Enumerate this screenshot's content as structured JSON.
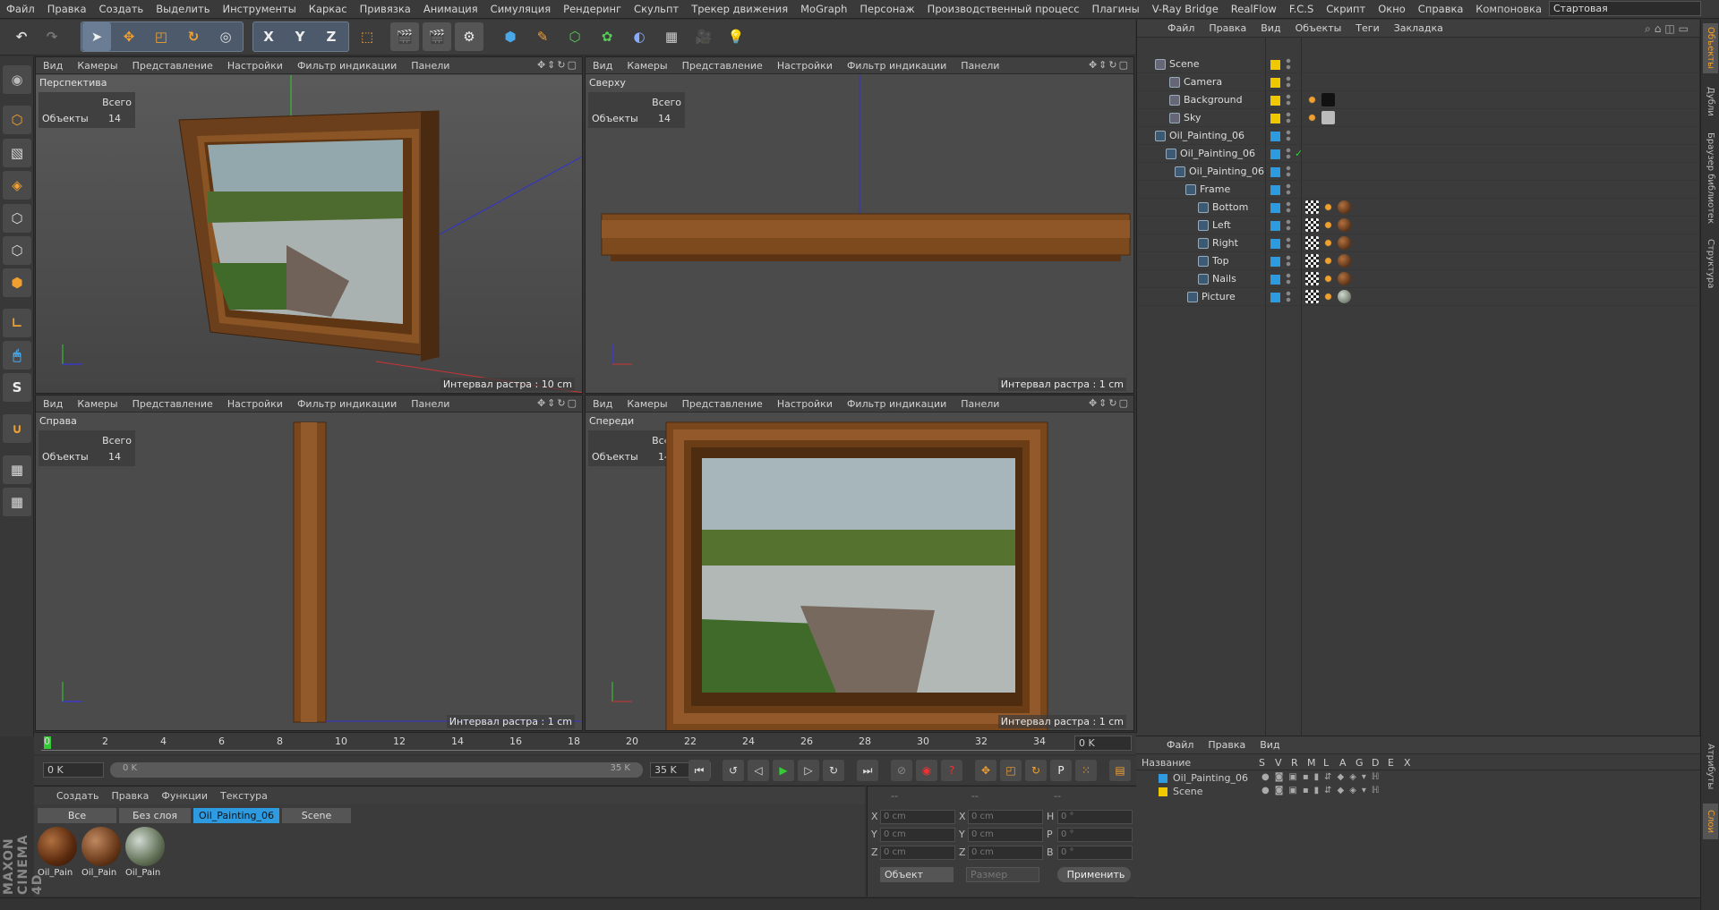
{
  "menubar": {
    "items": [
      "Файл",
      "Правка",
      "Создать",
      "Выделить",
      "Инструменты",
      "Каркас",
      "Привязка",
      "Анимация",
      "Симуляция",
      "Рендеринг",
      "Скульпт",
      "Трекер движения",
      "MoGraph",
      "Персонаж",
      "Производственный процесс",
      "Плагины",
      "V-Ray Bridge",
      "RealFlow",
      "F.C.S",
      "Скрипт",
      "Окно",
      "Справка"
    ],
    "layout_label": "Компоновка",
    "layout_value": "Стартовая"
  },
  "toolbar": {
    "icons": [
      "undo-icon",
      "redo-icon",
      "select-icon",
      "move-icon",
      "scale-icon",
      "rotate-icon",
      "live-select-icon",
      "x-axis-icon",
      "y-axis-icon",
      "z-axis-icon",
      "coord-system-icon",
      "render-view-icon",
      "render-picture-icon",
      "render-settings-icon",
      "cube-icon",
      "pen-icon",
      "subdivision-icon",
      "mograph-icon",
      "deformer-icon",
      "floor-icon",
      "camera-icon",
      "light-icon"
    ],
    "axis_labels": [
      "X",
      "Y",
      "Z"
    ]
  },
  "viewport_menu": [
    "Вид",
    "Камеры",
    "Представление",
    "Настройки",
    "Фильтр индикации",
    "Панели"
  ],
  "viewports": [
    {
      "name": "Перспектива",
      "grid": "Интервал растра : 10 cm"
    },
    {
      "name": "Сверху",
      "grid": "Интервал растра : 1 cm"
    },
    {
      "name": "Справа",
      "grid": "Интервал растра : 1 cm"
    },
    {
      "name": "Спереди",
      "grid": "Интервал растра : 1 cm"
    }
  ],
  "hud": {
    "total_label": "Всего",
    "objects_label": "Объекты",
    "objects_count": "14"
  },
  "object_manager": {
    "menu": [
      "Файл",
      "Правка",
      "Вид",
      "Объекты",
      "Теги",
      "Закладка"
    ],
    "rows": [
      {
        "name": "Scene",
        "color": "#f0c800"
      },
      {
        "name": "Camera",
        "color": "#f0c800"
      },
      {
        "name": "Background",
        "color": "#f0c800"
      },
      {
        "name": "Sky",
        "color": "#f0c800"
      },
      {
        "name": "Oil_Painting_06",
        "color": "#2e9ae0"
      },
      {
        "name": "Oil_Painting_06",
        "color": "#2e9ae0"
      },
      {
        "name": "Oil_Painting_06",
        "color": "#2e9ae0"
      },
      {
        "name": "Frame",
        "color": "#2e9ae0"
      },
      {
        "name": "Bottom",
        "color": "#2e9ae0"
      },
      {
        "name": "Left",
        "color": "#2e9ae0"
      },
      {
        "name": "Right",
        "color": "#2e9ae0"
      },
      {
        "name": "Top",
        "color": "#2e9ae0"
      },
      {
        "name": "Nails",
        "color": "#2e9ae0"
      },
      {
        "name": "Picture",
        "color": "#2e9ae0"
      }
    ]
  },
  "side_tabs": [
    "Объекты",
    "Дубли",
    "Браузер библиотек",
    "Структура",
    "Атрибуты",
    "Слои"
  ],
  "timeline": {
    "ticks": [
      "0",
      "2",
      "4",
      "6",
      "8",
      "10",
      "12",
      "14",
      "16",
      "18",
      "20",
      "22",
      "24",
      "26",
      "28",
      "30",
      "32",
      "34"
    ],
    "end_field": "0 K"
  },
  "transport": {
    "start": "0 K",
    "range_start": "0 K",
    "range_end": "35 K",
    "end": "35 K"
  },
  "material_manager": {
    "menu": [
      "Создать",
      "Правка",
      "Функции",
      "Текстура"
    ],
    "tabs": [
      "Все",
      "Без слоя",
      "Oil_Painting_06",
      "Scene"
    ],
    "materials": [
      {
        "label": "Oil_Pain"
      },
      {
        "label": "Oil_Pain"
      },
      {
        "label": "Oil_Pain"
      }
    ]
  },
  "coordinates": {
    "header": [
      "--",
      "--",
      "--"
    ],
    "rows": [
      {
        "a": "X",
        "av": "0 cm",
        "b": "X",
        "bv": "0 cm",
        "c": "H",
        "cv": "0 °"
      },
      {
        "a": "Y",
        "av": "0 cm",
        "b": "Y",
        "bv": "0 cm",
        "c": "P",
        "cv": "0 °"
      },
      {
        "a": "Z",
        "av": "0 cm",
        "b": "Z",
        "bv": "0 cm",
        "c": "B",
        "cv": "0 °"
      }
    ],
    "mode": "Объект",
    "size": "Размер",
    "apply": "Применить"
  },
  "layers": {
    "menu": [
      "Файл",
      "Правка",
      "Вид"
    ],
    "header_name": "Название",
    "columns": [
      "S",
      "V",
      "R",
      "M",
      "L",
      "A",
      "G",
      "D",
      "E",
      "X"
    ],
    "rows": [
      {
        "name": "Oil_Painting_06",
        "color": "#2e9ae0"
      },
      {
        "name": "Scene",
        "color": "#f0c800"
      }
    ]
  },
  "logo": "MAXON CINEMA 4D"
}
